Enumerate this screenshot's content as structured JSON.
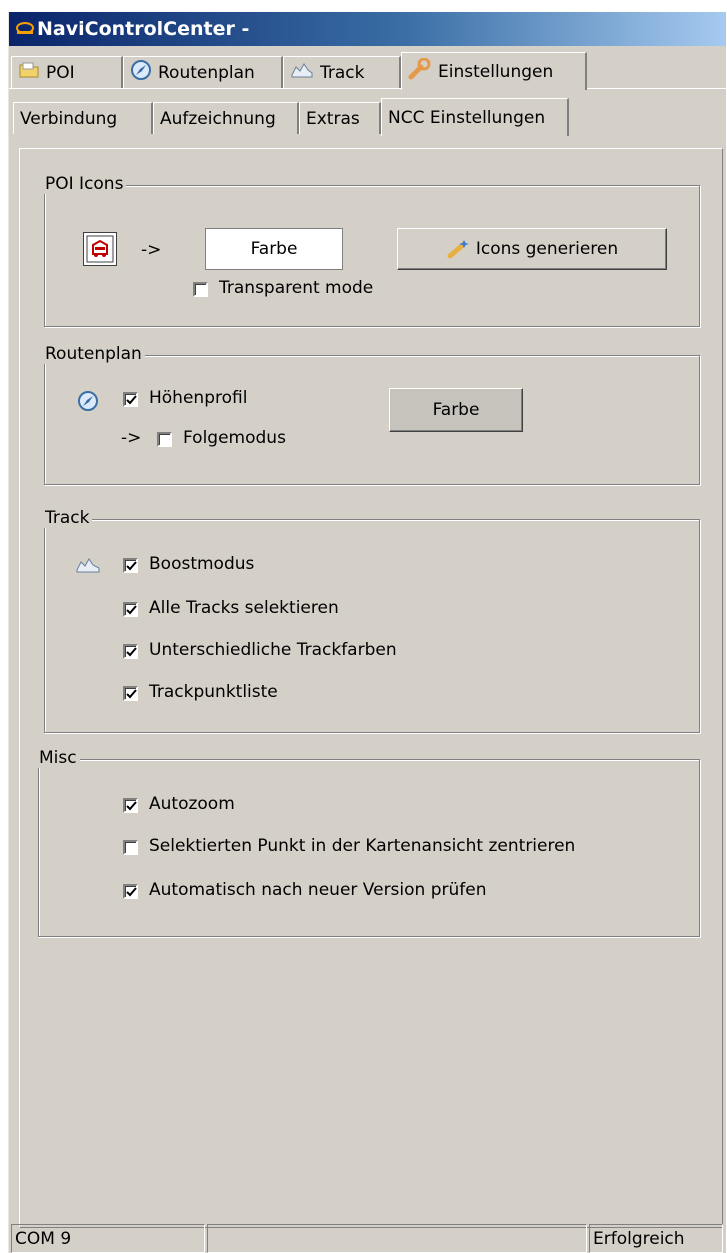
{
  "window": {
    "title": "NaviControlCenter -"
  },
  "main_tabs": [
    {
      "label": "POI",
      "icon": "poi-folder-icon"
    },
    {
      "label": "Routenplan",
      "icon": "compass-icon"
    },
    {
      "label": "Track",
      "icon": "track-icon"
    },
    {
      "label": "Einstellungen",
      "icon": "wrench-icon",
      "active": true
    }
  ],
  "sub_tabs": [
    {
      "label": "Verbindung"
    },
    {
      "label": "Aufzeichnung"
    },
    {
      "label": "Extras"
    },
    {
      "label": "NCC Einstellungen",
      "active": true
    }
  ],
  "poi_icons": {
    "legend": "POI Icons",
    "arrow": "->",
    "color_field": "Farbe",
    "generate_button": "Icons generieren",
    "transparent_label": "Transparent mode",
    "transparent_checked": false
  },
  "routenplan": {
    "legend": "Routenplan",
    "hoehenprofil_label": "Höhenprofil",
    "hoehenprofil_checked": true,
    "arrow": "->",
    "folgemodus_label": "Folgemodus",
    "folgemodus_checked": false,
    "color_button": "Farbe"
  },
  "track": {
    "legend": "Track",
    "options": [
      {
        "label": "Boostmodus",
        "checked": true
      },
      {
        "label": "Alle Tracks selektieren",
        "checked": true
      },
      {
        "label": "Unterschiedliche Trackfarben",
        "checked": true
      },
      {
        "label": "Trackpunktliste",
        "checked": true
      }
    ]
  },
  "misc": {
    "legend": "Misc",
    "options": [
      {
        "label": "Autozoom",
        "checked": true
      },
      {
        "label": "Selektierten Punkt in der Kartenansicht zentrieren",
        "checked": false
      },
      {
        "label": "Automatisch nach neuer Version prüfen",
        "checked": true
      }
    ]
  },
  "statusbar": {
    "port": "COM 9",
    "middle": "",
    "status": "Erfolgreich"
  }
}
